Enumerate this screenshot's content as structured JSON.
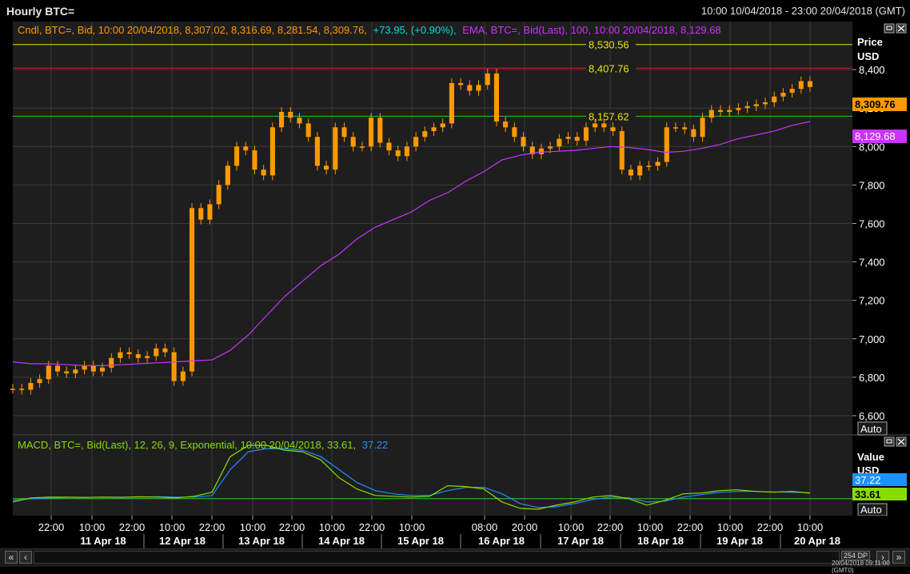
{
  "header": {
    "title": "Hourly BTC=",
    "range": "10:00 10/04/2018 - 23:00 20/04/2018 (GMT)"
  },
  "price_panel": {
    "legend_candle": "Cndl, BTC=, Bid, 10:00 20/04/2018, 8,307.02, 8,316.69, 8,281.54, 8,309.76,",
    "legend_change": "+73.95, (+0.90%),",
    "legend_ema": "EMA, BTC=, Bid(Last),  100, 10:00 20/04/2018, 8,129.68",
    "axis_title_1": "Price",
    "axis_title_2": "USD",
    "auto_label": "Auto",
    "last_price_tag": "8,309.76",
    "ema_tag": "8,129.68",
    "hlines": [
      {
        "value": 8530.56,
        "label": "8,530.56",
        "color": "#e8e800"
      },
      {
        "value": 8407.76,
        "label": "8,407.76",
        "color": "#cc2222"
      },
      {
        "value": 8157.62,
        "label": "8,157.62",
        "color": "#22cc22"
      }
    ]
  },
  "macd_panel": {
    "legend_main": "MACD, BTC=, Bid(Last),  12, 26, 9, Exponential, 10:00 20/04/2018, 33.61,",
    "legend_signal": "37.22",
    "axis_title_1": "Value",
    "axis_title_2": "USD",
    "auto_label": "Auto",
    "signal_tag": "37.22",
    "macd_tag": "33.61"
  },
  "footer": {
    "dp_label": "254 DP",
    "timestamp": "20/04/2018 09:11:00 (GMT0)"
  },
  "colors": {
    "candle": "#ff9900",
    "ema": "#cc33ff",
    "macd": "#88dd00",
    "signal": "#1e90ff",
    "zero_line": "#33cc33",
    "grid": "#3a3a3a",
    "panel_bg": "#1e1e1e"
  },
  "chart_data": [
    {
      "type": "line",
      "title": "Hourly BTC=",
      "ylabel": "Price USD",
      "ylim": [
        6500,
        8650
      ],
      "yticks": [
        6600,
        6800,
        7000,
        7200,
        7400,
        7600,
        7800,
        8000,
        8200,
        8400
      ],
      "ytick_labels": [
        "6,600",
        "6,800",
        "7,000",
        "7,200",
        "7,400",
        "7,600",
        "7,800",
        "8,000",
        "8,200",
        "8,400"
      ],
      "x_hour_labels": [
        "22:00",
        "10:00",
        "22:00",
        "10:00",
        "22:00",
        "10:00",
        "22:00",
        "10:00",
        "22:00",
        "10:00",
        "08:00",
        "20:00",
        "10:00",
        "22:00",
        "10:00",
        "22:00",
        "10:00",
        "22:00",
        "10:00"
      ],
      "x_day_labels": [
        "11 Apr 18",
        "12 Apr 18",
        "13 Apr 18",
        "14 Apr 18",
        "15 Apr 18",
        "16 Apr 18",
        "17 Apr 18",
        "18 Apr 18",
        "19 Apr 18",
        "20 Apr 18"
      ],
      "series": [
        {
          "name": "Cndl, BTC=, Bid",
          "values": [
            6740,
            6735,
            6770,
            6790,
            6860,
            6830,
            6820,
            6840,
            6860,
            6830,
            6850,
            6900,
            6930,
            6920,
            6900,
            6910,
            6950,
            6930,
            6780,
            6830,
            7680,
            7620,
            7700,
            7800,
            7900,
            8000,
            7980,
            7880,
            7850,
            8100,
            8180,
            8150,
            8120,
            8050,
            7900,
            7880,
            8100,
            8050,
            8000,
            8000,
            8150,
            8020,
            7980,
            7950,
            8000,
            8050,
            8080,
            8100,
            8120,
            8330,
            8320,
            8290,
            8320,
            8380,
            8130,
            8100,
            8050,
            8000,
            7960,
            7990,
            8000,
            8040,
            8050,
            8030,
            8100,
            8120,
            8100,
            8080,
            7880,
            7850,
            7900,
            7900,
            7920,
            8100,
            8100,
            8090,
            8050,
            8150,
            8190,
            8180,
            8190,
            8200,
            8210,
            8220,
            8230,
            8260,
            8280,
            8300,
            8340,
            8310
          ]
        },
        {
          "name": "EMA, BTC=, Bid(Last), 100",
          "values": [
            6880,
            6870,
            6870,
            6865,
            6860,
            6860,
            6865,
            6870,
            6875,
            6880,
            6885,
            6890,
            6940,
            7020,
            7120,
            7220,
            7300,
            7380,
            7440,
            7520,
            7580,
            7620,
            7660,
            7720,
            7760,
            7820,
            7870,
            7930,
            7955,
            7970,
            7975,
            7980,
            7990,
            8000,
            7995,
            7985,
            7970,
            7975,
            7990,
            8010,
            8040,
            8060,
            8080,
            8110,
            8130
          ]
        }
      ]
    },
    {
      "type": "line",
      "title": "MACD, BTC=, Bid(Last), 12, 26, 9, Exponential",
      "ylabel": "Value USD",
      "series": [
        {
          "name": "MACD",
          "values": [
            -20,
            5,
            10,
            10,
            8,
            10,
            8,
            12,
            10,
            5,
            15,
            40,
            260,
            330,
            330,
            300,
            290,
            240,
            130,
            60,
            20,
            15,
            10,
            15,
            80,
            75,
            60,
            -20,
            -60,
            -65,
            -40,
            -20,
            10,
            20,
            0,
            -40,
            -10,
            30,
            35,
            50,
            55,
            45,
            40,
            45,
            34
          ]
        },
        {
          "name": "Signal",
          "values": [
            -10,
            0,
            5,
            8,
            8,
            10,
            10,
            10,
            12,
            10,
            10,
            20,
            180,
            290,
            310,
            310,
            300,
            260,
            180,
            100,
            50,
            30,
            20,
            20,
            50,
            70,
            70,
            30,
            -30,
            -55,
            -50,
            -30,
            -5,
            10,
            5,
            -20,
            -15,
            10,
            25,
            40,
            45,
            45,
            42,
            40,
            37
          ]
        }
      ]
    }
  ]
}
